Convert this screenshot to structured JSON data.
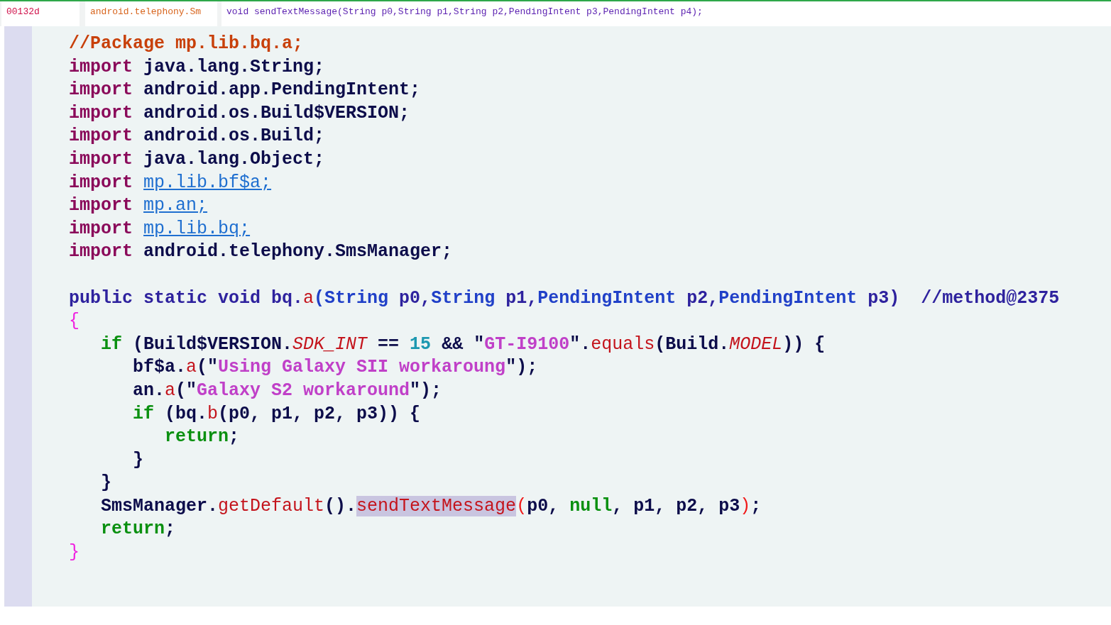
{
  "header": {
    "offset": "00132d",
    "class_name": "android.telephony.Sm",
    "signature": "void sendTextMessage(String p0,String p1,String p2,PendingIntent p3,PendingIntent p4);"
  },
  "code": [
    {
      "tokens": [
        {
          "kind": "comment",
          "text": "//Package mp.lib.bq.a;"
        }
      ]
    },
    {
      "tokens": [
        {
          "kind": "keyword",
          "text": "import "
        },
        {
          "kind": "plain",
          "text": "java.lang.String;"
        }
      ]
    },
    {
      "tokens": [
        {
          "kind": "keyword",
          "text": "import "
        },
        {
          "kind": "plain",
          "text": "android.app.PendingIntent;"
        }
      ]
    },
    {
      "tokens": [
        {
          "kind": "keyword",
          "text": "import "
        },
        {
          "kind": "plain",
          "text": "android.os.Build$VERSION;"
        }
      ]
    },
    {
      "tokens": [
        {
          "kind": "keyword",
          "text": "import "
        },
        {
          "kind": "plain",
          "text": "android.os.Build;"
        }
      ]
    },
    {
      "tokens": [
        {
          "kind": "keyword",
          "text": "import "
        },
        {
          "kind": "plain",
          "text": "java.lang.Object;"
        }
      ]
    },
    {
      "tokens": [
        {
          "kind": "keyword",
          "text": "import "
        },
        {
          "kind": "link",
          "text": "mp.lib.bf$a;"
        }
      ]
    },
    {
      "tokens": [
        {
          "kind": "keyword",
          "text": "import "
        },
        {
          "kind": "link",
          "text": "mp.an;"
        }
      ]
    },
    {
      "tokens": [
        {
          "kind": "keyword",
          "text": "import "
        },
        {
          "kind": "link",
          "text": "mp.lib.bq;"
        }
      ]
    },
    {
      "tokens": [
        {
          "kind": "keyword",
          "text": "import "
        },
        {
          "kind": "plain",
          "text": "android.telephony.SmsManager;"
        }
      ]
    },
    {
      "gap_before": true,
      "tokens": [
        {
          "kind": "declaration",
          "text": "public static void "
        },
        {
          "kind": "declaration",
          "text": "bq."
        },
        {
          "kind": "method",
          "text": "a"
        },
        {
          "kind": "type",
          "text": "(String "
        },
        {
          "kind": "declaration",
          "text": "p0,"
        },
        {
          "kind": "type",
          "text": "String "
        },
        {
          "kind": "declaration",
          "text": "p1,"
        },
        {
          "kind": "type",
          "text": "PendingIntent "
        },
        {
          "kind": "declaration",
          "text": "p2,"
        },
        {
          "kind": "type",
          "text": "PendingIntent "
        },
        {
          "kind": "declaration",
          "text": "p3)  //method@2375"
        }
      ]
    },
    {
      "tokens": [
        {
          "kind": "brace",
          "text": "{"
        }
      ],
      "children": [
        {
          "tokens": [
            {
              "kind": "control",
              "text": "if "
            },
            {
              "kind": "plain",
              "text": "(Build$VERSION."
            },
            {
              "kind": "field",
              "text": "SDK_INT"
            },
            {
              "kind": "plain",
              "text": " == "
            },
            {
              "kind": "number",
              "text": "15"
            },
            {
              "kind": "plain",
              "text": " && \""
            },
            {
              "kind": "string",
              "text": "GT-I9100"
            },
            {
              "kind": "plain",
              "text": "\"."
            },
            {
              "kind": "method",
              "text": "equals"
            },
            {
              "kind": "plain",
              "text": "(Build."
            },
            {
              "kind": "field",
              "text": "MODEL"
            },
            {
              "kind": "plain",
              "text": ")) {"
            }
          ],
          "children": [
            {
              "tokens": [
                {
                  "kind": "plain",
                  "text": "bf$a."
                },
                {
                  "kind": "method",
                  "text": "a"
                },
                {
                  "kind": "plain",
                  "text": "(\""
                },
                {
                  "kind": "string",
                  "text": "Using Galaxy SII workaroung"
                },
                {
                  "kind": "plain",
                  "text": "\");"
                }
              ]
            },
            {
              "tokens": [
                {
                  "kind": "plain",
                  "text": "an."
                },
                {
                  "kind": "method",
                  "text": "a"
                },
                {
                  "kind": "plain",
                  "text": "(\""
                },
                {
                  "kind": "string",
                  "text": "Galaxy S2 workaround"
                },
                {
                  "kind": "plain",
                  "text": "\");"
                }
              ]
            },
            {
              "tokens": [
                {
                  "kind": "control",
                  "text": "if "
                },
                {
                  "kind": "plain",
                  "text": "(bq."
                },
                {
                  "kind": "method",
                  "text": "b"
                },
                {
                  "kind": "plain",
                  "text": "(p0, p1, p2, p3)) {"
                }
              ],
              "children": [
                {
                  "tokens": [
                    {
                      "kind": "control",
                      "text": "return"
                    },
                    {
                      "kind": "plain",
                      "text": ";"
                    }
                  ]
                }
              ]
            },
            {
              "tokens": [
                {
                  "kind": "plain",
                  "text": "}"
                }
              ]
            }
          ]
        },
        {
          "tokens": [
            {
              "kind": "plain",
              "text": "}"
            }
          ]
        },
        {
          "tokens": [
            {
              "kind": "plain",
              "text": "SmsManager."
            },
            {
              "kind": "method",
              "text": "getDefault"
            },
            {
              "kind": "plain",
              "text": "()."
            },
            {
              "kind": "highlight",
              "text": "sendTextMessage"
            },
            {
              "kind": "paren",
              "text": "("
            },
            {
              "kind": "plain",
              "text": "p0, "
            },
            {
              "kind": "control",
              "text": "null"
            },
            {
              "kind": "plain",
              "text": ", p1, p2, p3"
            },
            {
              "kind": "paren",
              "text": ")"
            },
            {
              "kind": "plain",
              "text": ";"
            }
          ]
        },
        {
          "tokens": [
            {
              "kind": "control",
              "text": "return"
            },
            {
              "kind": "plain",
              "text": ";"
            }
          ]
        }
      ]
    },
    {
      "tokens": [
        {
          "kind": "brace",
          "text": "}"
        }
      ]
    }
  ]
}
